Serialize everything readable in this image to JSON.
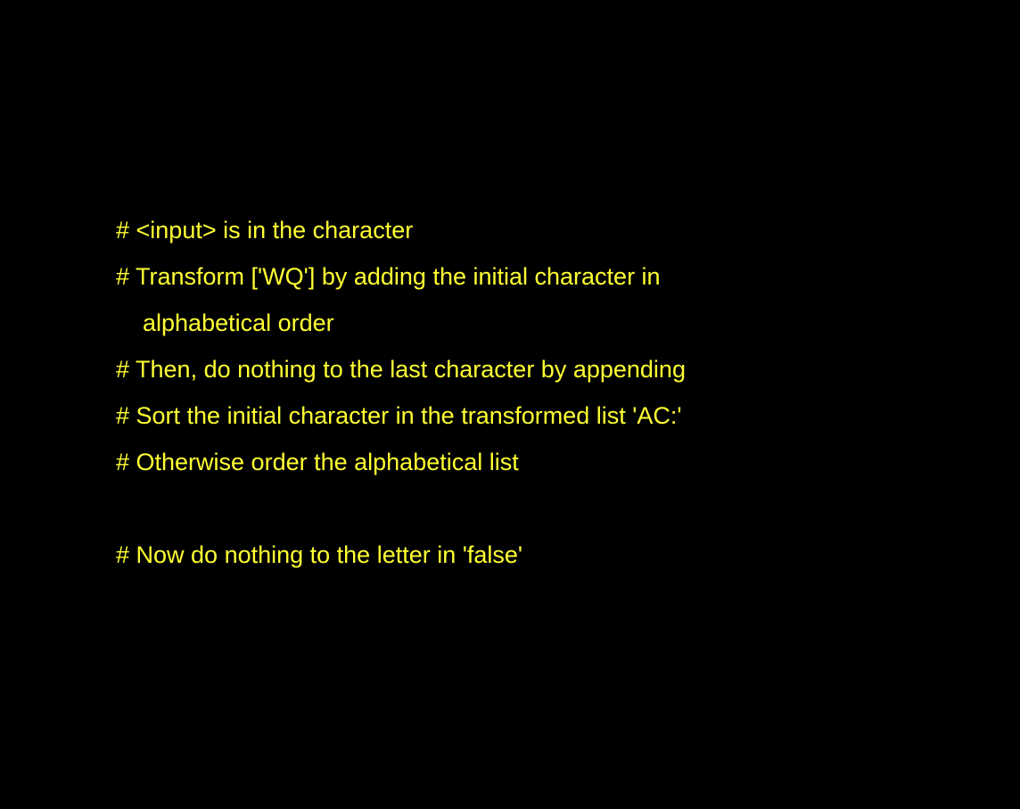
{
  "text_color": "#ffff33",
  "background_color": "#000000",
  "lines": [
    {
      "text": "# <input> is in the character"
    },
    {
      "text": "# Transform ['WQ'] by adding the initial character in"
    },
    {
      "text": "alphabetical order"
    },
    {
      "text": "# Then, do nothing to the last character by appending"
    },
    {
      "text": "# Sort the initial character in the transformed list 'AC:'"
    },
    {
      "text": "# Otherwise order the alphabetical list"
    },
    {
      "text": ""
    },
    {
      "text": "# Now do nothing to the letter in 'false'"
    }
  ]
}
